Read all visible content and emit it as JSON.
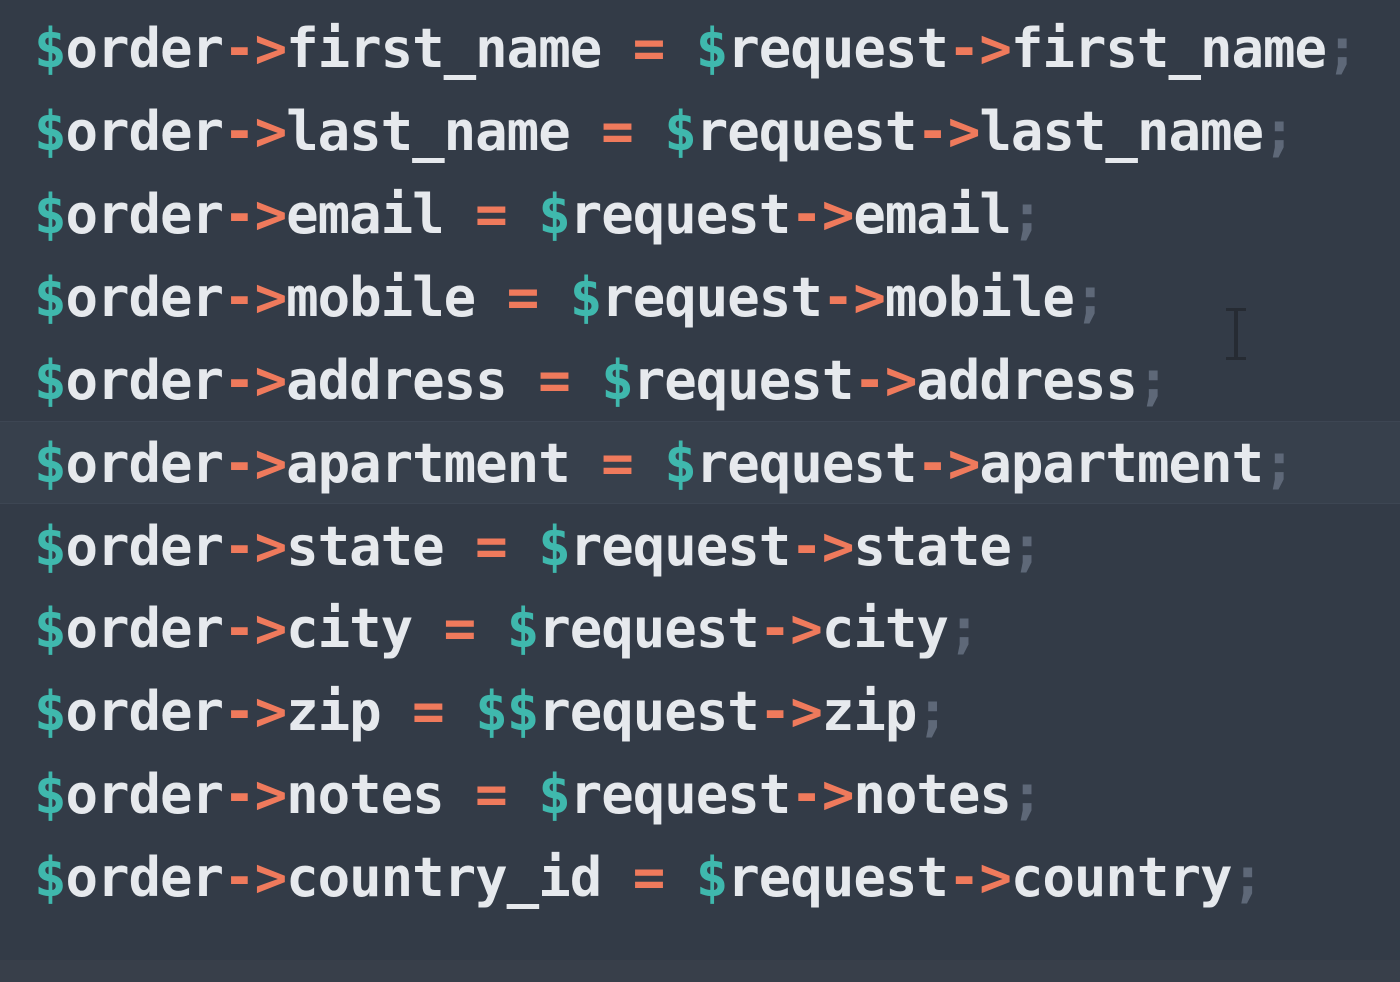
{
  "code": {
    "lines": [
      {
        "dollar": "$",
        "var": "order",
        "arrow": "->",
        "prop": "first_name",
        "eq": " = ",
        "rdollar": "$",
        "rvar": "request",
        "rarrow": "->",
        "rprop": "first_name",
        "semi": ";"
      },
      {
        "dollar": "$",
        "var": "order",
        "arrow": "->",
        "prop": "last_name",
        "eq": " = ",
        "rdollar": "$",
        "rvar": "request",
        "rarrow": "->",
        "rprop": "last_name",
        "semi": ";"
      },
      {
        "dollar": "$",
        "var": "order",
        "arrow": "->",
        "prop": "email",
        "eq": " = ",
        "rdollar": "$",
        "rvar": "request",
        "rarrow": "->",
        "rprop": "email",
        "semi": ";"
      },
      {
        "dollar": "$",
        "var": "order",
        "arrow": "->",
        "prop": "mobile",
        "eq": " = ",
        "rdollar": "$",
        "rvar": "request",
        "rarrow": "->",
        "rprop": "mobile",
        "semi": ";"
      },
      {
        "dollar": "$",
        "var": "order",
        "arrow": "->",
        "prop": "address",
        "eq": " = ",
        "rdollar": "$",
        "rvar": "request",
        "rarrow": "->",
        "rprop": "address",
        "semi": ";"
      },
      {
        "dollar": "$",
        "var": "order",
        "arrow": "->",
        "prop": "apartment",
        "eq": " = ",
        "rdollar": "$",
        "rvar": "request",
        "rarrow": "->",
        "rprop": "apartment",
        "semi": ";"
      },
      {
        "dollar": "$",
        "var": "order",
        "arrow": "->",
        "prop": "state",
        "eq": " = ",
        "rdollar": "$",
        "rvar": "request",
        "rarrow": "->",
        "rprop": "state",
        "semi": ";"
      },
      {
        "dollar": "$",
        "var": "order",
        "arrow": "->",
        "prop": "city",
        "eq": " = ",
        "rdollar": "$",
        "rvar": "request",
        "rarrow": "->",
        "rprop": "city",
        "semi": ";"
      },
      {
        "dollar": "$",
        "var": "order",
        "arrow": "->",
        "prop": "zip",
        "eq": " = ",
        "rdollar": "$$",
        "rvar": "request",
        "rarrow": "->",
        "rprop": "zip",
        "semi": ";"
      },
      {
        "dollar": "$",
        "var": "order",
        "arrow": "->",
        "prop": "notes",
        "eq": " = ",
        "rdollar": "$",
        "rvar": "request",
        "rarrow": "->",
        "rprop": "notes",
        "semi": ";"
      },
      {
        "dollar": "$",
        "var": "order",
        "arrow": "->",
        "prop": "country_id",
        "eq": " = ",
        "rdollar": "$",
        "rvar": "request",
        "rarrow": "->",
        "rprop": "country",
        "semi": ";"
      }
    ]
  },
  "colors": {
    "background": "#333b47",
    "variable_sigil": "#3fb8ad",
    "operator": "#ef7a5c",
    "identifier": "#e6e9ed",
    "punctuation": "#5e6878"
  },
  "icons": {
    "text_cursor": "i-beam-cursor-icon"
  }
}
